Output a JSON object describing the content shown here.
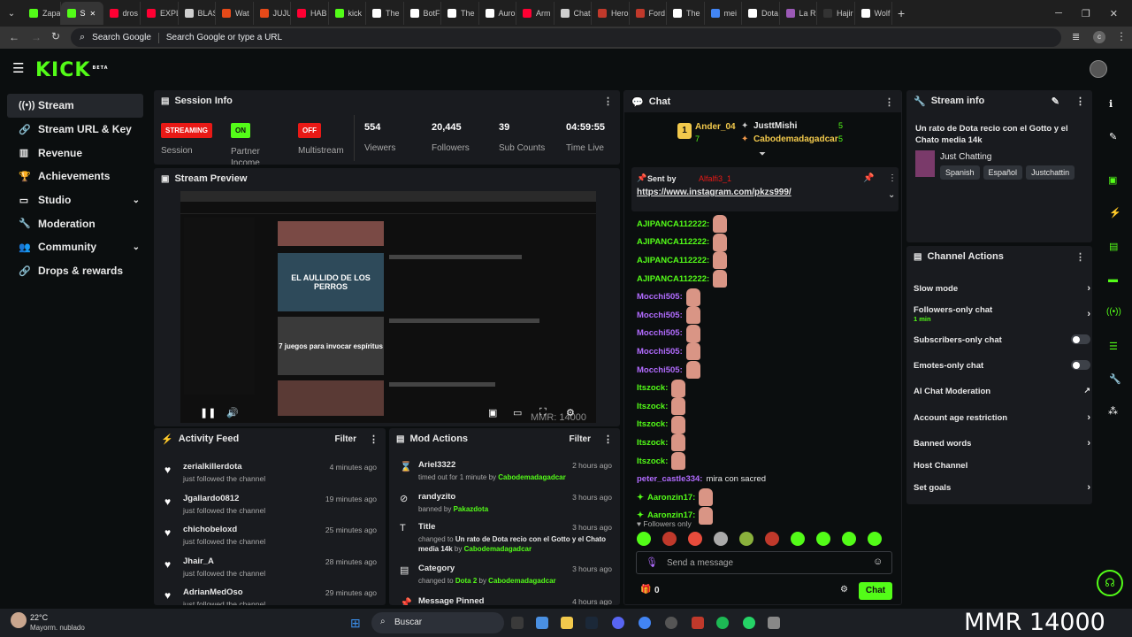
{
  "browser": {
    "tabs": [
      {
        "label": "Zapa",
        "color": "#53fc18"
      },
      {
        "label": "S",
        "color": "#53fc18",
        "active": true
      },
      {
        "label": "dros",
        "color": "#ff0033"
      },
      {
        "label": "EXPL",
        "color": "#ff0033"
      },
      {
        "label": "BLAS",
        "color": "#cfcfcf"
      },
      {
        "label": "Wat",
        "color": "#e64a19"
      },
      {
        "label": "JUJU",
        "color": "#e64a19"
      },
      {
        "label": "HAB",
        "color": "#ff0033"
      },
      {
        "label": "kick",
        "color": "#53fc18"
      },
      {
        "label": "The",
        "color": "#ffffff"
      },
      {
        "label": "BotF",
        "color": "#ffffff"
      },
      {
        "label": "The",
        "color": "#ffffff"
      },
      {
        "label": "Auro",
        "color": "#ffffff"
      },
      {
        "label": "Arm",
        "color": "#ff0033"
      },
      {
        "label": "Chat",
        "color": "#cfcfcf"
      },
      {
        "label": "Hero",
        "color": "#c0392b"
      },
      {
        "label": "Ford",
        "color": "#c0392b"
      },
      {
        "label": "The",
        "color": "#ffffff"
      },
      {
        "label": "mei",
        "color": "#4285f4"
      },
      {
        "label": "Dota",
        "color": "#ffffff"
      },
      {
        "label": "La R",
        "color": "#9b59b6"
      },
      {
        "label": "Hajir",
        "color": "#333333"
      },
      {
        "label": "Wolf",
        "color": "#ffffff"
      }
    ],
    "address": {
      "search_label": "Search Google",
      "placeholder": "Search Google or type a URL"
    }
  },
  "kick": {
    "logo": "KICK",
    "beta": "BETA"
  },
  "sidebar": {
    "items": [
      {
        "label": "Stream",
        "icon": "radio-icon"
      },
      {
        "label": "Stream URL & Key",
        "icon": "link-icon"
      },
      {
        "label": "Revenue",
        "icon": "chart-icon"
      },
      {
        "label": "Achievements",
        "icon": "trophy-icon"
      },
      {
        "label": "Studio",
        "icon": "monitor-icon"
      },
      {
        "label": "Moderation",
        "icon": "wrench-icon"
      },
      {
        "label": "Community",
        "icon": "users-icon"
      },
      {
        "label": "Drops & rewards",
        "icon": "link-icon"
      }
    ]
  },
  "session": {
    "title": "Session Info",
    "streaming": "STREAMING",
    "streaming_label": "Session",
    "on": "ON",
    "partner_label": "Partner Income",
    "off": "OFF",
    "multistream_label": "Multistream",
    "stats": [
      {
        "value": "554",
        "label": "Viewers"
      },
      {
        "value": "20,445",
        "label": "Followers"
      },
      {
        "value": "39",
        "label": "Sub Counts"
      },
      {
        "value": "04:59:55",
        "label": "Time Live"
      }
    ]
  },
  "preview": {
    "title": "Stream Preview",
    "video_titles": [
      "EL AULLIDO DE LOS PERROS",
      "7 juegos para invocar espíritus"
    ],
    "watermark": "MMR: 14000"
  },
  "activity": {
    "title": "Activity Feed",
    "filter": "Filter",
    "items": [
      {
        "name": "zerialkillerdota",
        "time": "4 minutes ago",
        "sub": "just followed the channel"
      },
      {
        "name": "Jgallardo0812",
        "time": "19 minutes ago",
        "sub": "just followed the channel"
      },
      {
        "name": "chichobeloxd",
        "time": "25 minutes ago",
        "sub": "just followed the channel"
      },
      {
        "name": "Jhair_A",
        "time": "28 minutes ago",
        "sub": "just followed the channel"
      },
      {
        "name": "AdrianMedOso",
        "time": "29 minutes ago",
        "sub": "just followed the channel"
      }
    ]
  },
  "mod": {
    "title": "Mod Actions",
    "filter": "Filter",
    "items": [
      {
        "name": "Ariel3322",
        "time": "2 hours ago",
        "pre": "timed out for 1 minute by ",
        "mid": "",
        "by": "Cabodemadagadcar",
        "icon": "hourglass-icon"
      },
      {
        "name": "randyzito",
        "time": "3 hours ago",
        "pre": "banned by ",
        "mid": "",
        "by": "Pakazdota",
        "icon": "ban-icon"
      },
      {
        "name": "Title",
        "time": "3 hours ago",
        "pre": "changed to ",
        "mid": "Un rato de Dota recio con el Gotto y el Chato media 14k",
        "by": "Cabodemadagadcar",
        "icon": "title-icon"
      },
      {
        "name": "Category",
        "time": "3 hours ago",
        "pre": "changed to ",
        "mid": "Dota 2",
        "by": "Cabodemadagadcar",
        "icon": "category-icon"
      },
      {
        "name": "Message Pinned",
        "time": "4 hours ago",
        "pre": "",
        "mid": "",
        "by": "",
        "icon": "pin-icon"
      }
    ]
  },
  "chat": {
    "title": "Chat",
    "leaders": [
      {
        "rank": "1",
        "name": "Ander_04",
        "count": "7"
      },
      {
        "name": "JusttMishi",
        "count": "5"
      },
      {
        "name": "Cabodemadagadcar",
        "count": "5"
      }
    ],
    "pinned": {
      "sent_by": "Sent by",
      "user": "Alfalfi3_1",
      "url": "https://www.instagram.com/pkzs999/"
    },
    "messages": [
      {
        "user": "AJIPANCA112222:",
        "color": "green"
      },
      {
        "user": "AJIPANCA112222:",
        "color": "green"
      },
      {
        "user": "AJIPANCA112222:",
        "color": "green"
      },
      {
        "user": "AJIPANCA112222:",
        "color": "green"
      },
      {
        "user": "Mocchi505:",
        "color": "purple"
      },
      {
        "user": "Mocchi505:",
        "color": "purple"
      },
      {
        "user": "Mocchi505:",
        "color": "purple"
      },
      {
        "user": "Mocchi505:",
        "color": "purple"
      },
      {
        "user": "Mocchi505:",
        "color": "purple"
      },
      {
        "user": "Itszock:",
        "color": "green"
      },
      {
        "user": "Itszock:",
        "color": "green"
      },
      {
        "user": "Itszock:",
        "color": "green"
      },
      {
        "user": "Itszock:",
        "color": "green"
      },
      {
        "user": "Itszock:",
        "color": "green"
      },
      {
        "user": "peter_castle334:",
        "color": "purple",
        "text": "mira con sacred"
      },
      {
        "user": "Aaronzin17:",
        "color": "green"
      },
      {
        "user": "Aaronzin17:",
        "color": "green"
      }
    ],
    "followers_only": "Followers only",
    "input_placeholder": "Send a message",
    "counter": "0",
    "send": "Chat"
  },
  "stream_info": {
    "title": "Stream info",
    "stream_title": "Un rato de Dota recio con el Gotto y el Chato media 14k",
    "category": "Just Chatting",
    "tags": [
      "Spanish",
      "Español",
      "Justchattin"
    ]
  },
  "channel_actions": {
    "title": "Channel Actions",
    "items": [
      {
        "label": "Slow mode",
        "kind": "chev"
      },
      {
        "label": "Followers-only chat",
        "kind": "chev",
        "sub": "1 min"
      },
      {
        "label": "Subscribers-only chat",
        "kind": "toggle"
      },
      {
        "label": "Emotes-only chat",
        "kind": "toggle"
      },
      {
        "label": "AI Chat Moderation",
        "kind": "ext"
      },
      {
        "label": "Account age restriction",
        "kind": "chev"
      },
      {
        "label": "Banned words",
        "kind": "chev"
      },
      {
        "label": "Host Channel",
        "kind": "none"
      },
      {
        "label": "Set goals",
        "kind": "chev"
      }
    ]
  },
  "taskbar": {
    "temp": "22°C",
    "weather": "Mayorm. nublado",
    "search": "Buscar",
    "overlay": "MMR 14000"
  }
}
